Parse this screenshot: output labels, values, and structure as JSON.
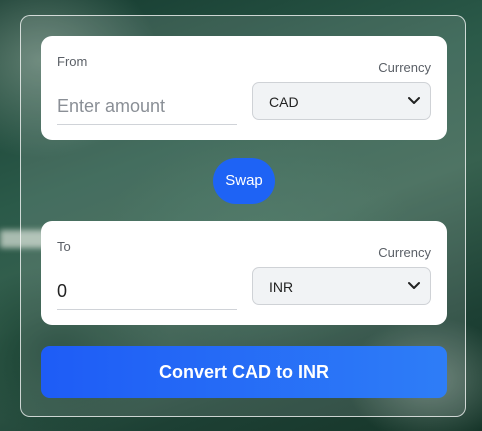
{
  "from_card": {
    "label": "From",
    "currency_label": "Currency",
    "amount_placeholder": "Enter amount",
    "currency_value": "CAD"
  },
  "swap_button": {
    "label": "Swap",
    "color": "#1e63f5"
  },
  "to_card": {
    "label": "To",
    "currency_label": "Currency",
    "amount_value": "0",
    "currency_value": "INR"
  },
  "convert_button": {
    "label": "Convert CAD to INR",
    "color": "#2a6ff6"
  }
}
